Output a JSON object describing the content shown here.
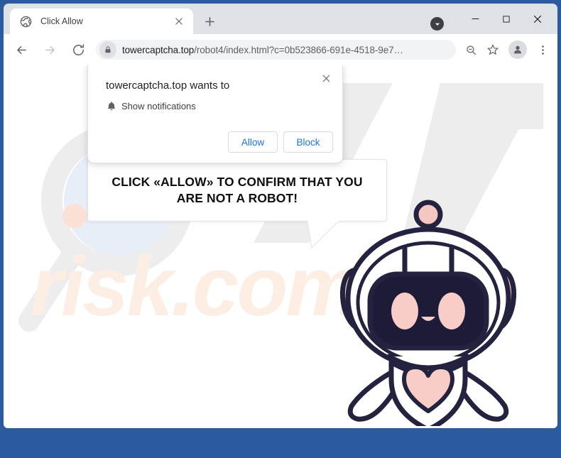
{
  "window": {
    "controls": {
      "minimize": "minimize-button",
      "maximize": "maximize-button",
      "close": "close-button"
    },
    "badge_icon": "caret-down-circle-icon"
  },
  "tabs": {
    "active": {
      "title": "Click Allow",
      "favicon": "globe-icon",
      "close_label": "Close tab"
    },
    "new_tab_label": "New Tab"
  },
  "toolbar": {
    "back": "back-arrow-icon",
    "forward": "forward-arrow-icon",
    "reload": "reload-icon",
    "zoom": "zoom-out-icon",
    "bookmark": "star-icon",
    "profile": "profile-avatar-icon",
    "menu": "three-dot-menu-icon"
  },
  "omnibox": {
    "lock_icon": "lock-icon",
    "host": "towercaptcha.top",
    "path": "/robot4/index.html?c=0b523866-691e-4518-9e7…",
    "full_url": "towercaptcha.top/robot4/index.html?c=0b523866-691e-4518-9e7…"
  },
  "permission_dialog": {
    "title": "towercaptcha.top wants to",
    "permission_icon": "bell-icon",
    "permission_label": "Show notifications",
    "allow_label": "Allow",
    "block_label": "Block",
    "close_label": "×"
  },
  "page_content": {
    "bubble_text": "CLICK «ALLOW» TO CONFIRM THAT YOU ARE NOT A ROBOT!",
    "mascot": "robot-mascot"
  },
  "watermark": {
    "text": "risk.com",
    "logo": "magnifier-logo"
  },
  "colors": {
    "window_frame": "#2c5a9e",
    "tabstrip": "#dee1e6",
    "omnibox": "#f1f3f4",
    "link_blue": "#1a73e8",
    "robot_outline": "#232340",
    "robot_pink": "#f8cdc8",
    "robot_visor": "#1e1b38",
    "watermark_gray": "#ededed",
    "watermark_peach": "#fdeee4",
    "watermark_blue": "#e8eef7"
  }
}
